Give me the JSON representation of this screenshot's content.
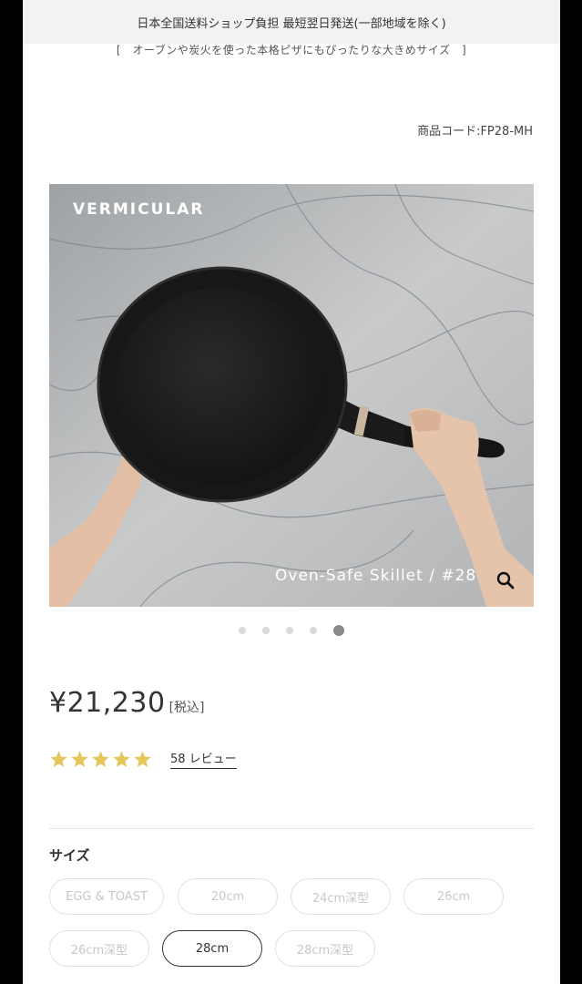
{
  "banner": {
    "text": "日本全国送料ショップ負担 最短翌日発送(一部地域を除く)"
  },
  "tagline": "[　オーブンや炭火を使った本格ピザにもぴったりな大きめサイズ　]",
  "product_code": "商品コード:FP28-MH",
  "hero": {
    "brand": "VERMICULAR",
    "caption": "Oven-Safe Skillet / #28",
    "zoom_icon": "magnifier-icon"
  },
  "carousel": {
    "total": 5,
    "active_index": 4
  },
  "price": {
    "amount": "¥21,230",
    "tax_label": "[税込]"
  },
  "rating": {
    "stars": 5,
    "max_stars": 5,
    "star_color": "#e4c65a",
    "reviews_label": "58 レビュー"
  },
  "size": {
    "label": "サイズ",
    "options": [
      {
        "label": "EGG & TOAST",
        "selected": false
      },
      {
        "label": "20cm",
        "selected": false
      },
      {
        "label": "24cm深型",
        "selected": false
      },
      {
        "label": "26cm",
        "selected": false
      },
      {
        "label": "26cm深型",
        "selected": false
      },
      {
        "label": "28cm",
        "selected": true
      },
      {
        "label": "28cm深型",
        "selected": false
      }
    ]
  }
}
